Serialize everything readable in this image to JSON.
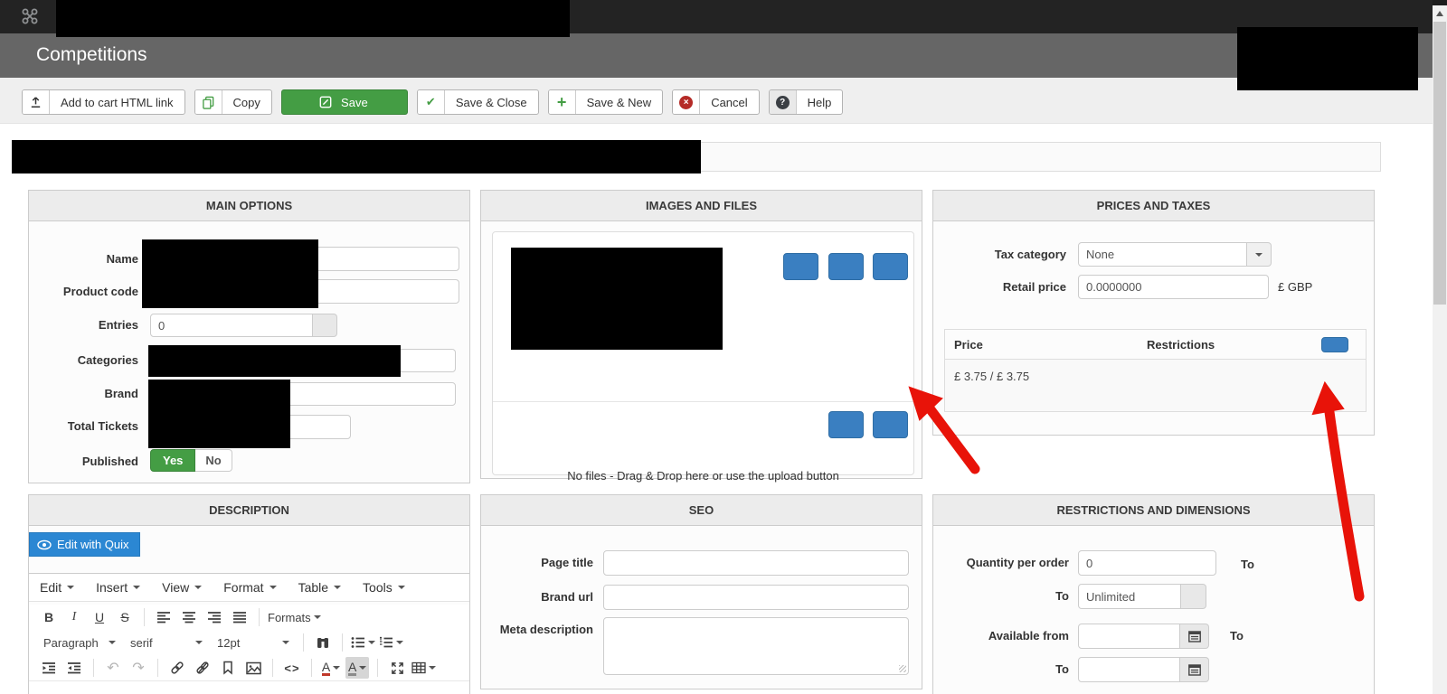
{
  "header": {
    "title": "Competitions"
  },
  "toolbar": {
    "add_to_cart": "Add to cart HTML link",
    "copy": "Copy",
    "save": "Save",
    "save_close": "Save & Close",
    "save_new": "Save & New",
    "cancel": "Cancel",
    "help": "Help"
  },
  "main_options": {
    "title": "MAIN OPTIONS",
    "name_label": "Name",
    "product_code_label": "Product code",
    "entries_label": "Entries",
    "entries_value": "0",
    "categories_label": "Categories",
    "brand_label": "Brand",
    "total_tickets_label": "Total Tickets",
    "published_label": "Published",
    "published_yes": "Yes",
    "published_no": "No"
  },
  "images_files": {
    "title": "IMAGES AND FILES",
    "no_files_text": "No files - Drag & Drop here or use the upload button"
  },
  "prices_taxes": {
    "title": "PRICES AND TAXES",
    "tax_category_label": "Tax category",
    "tax_category_value": "None",
    "retail_price_label": "Retail price",
    "retail_price_value": "0.0000000",
    "currency": "£ GBP",
    "col_price": "Price",
    "col_restrictions": "Restrictions",
    "price_row": "£ 3.75 / £ 3.75"
  },
  "description": {
    "title": "DESCRIPTION",
    "edit_with_quix": "Edit with Quix",
    "menu": [
      "Edit",
      "Insert",
      "View",
      "Format",
      "Table",
      "Tools"
    ],
    "bold": "B",
    "italic": "I",
    "underline": "U",
    "strike": "S",
    "formats": "Formats",
    "paragraph": "Paragraph",
    "font": "serif",
    "size": "12pt",
    "code_glyph": "<>",
    "color_glyph": "A",
    "undo_glyph": "↶",
    "redo_glyph": "↷"
  },
  "seo": {
    "title": "SEO",
    "page_title_label": "Page title",
    "brand_url_label": "Brand url",
    "meta_description_label": "Meta description"
  },
  "restrictions": {
    "title": "RESTRICTIONS AND DIMENSIONS",
    "quantity_label": "Quantity per order",
    "quantity_value": "0",
    "to_label": "To",
    "to_value": "Unlimited",
    "available_from_label": "Available from"
  },
  "colors": {
    "accent_blue": "#3a7fc1",
    "quix_blue": "#2b87d3",
    "save_green": "#449d44",
    "annotation_red": "#e81309"
  }
}
